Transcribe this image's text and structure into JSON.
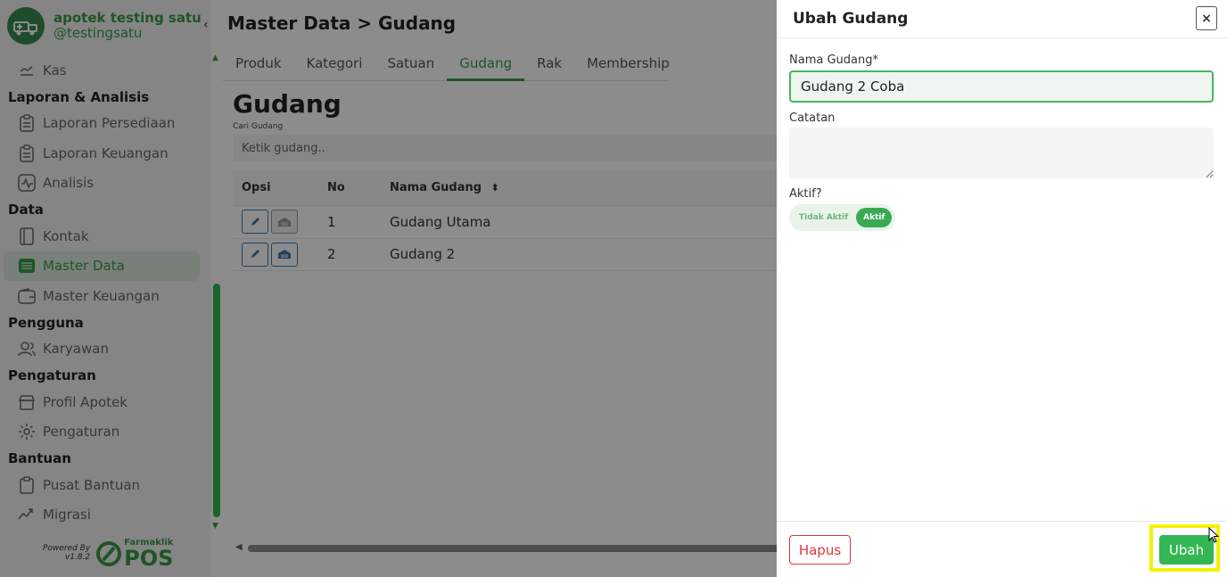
{
  "sidebar": {
    "brand_name": "apotek testing satu",
    "brand_handle": "@testingsatu",
    "collapse": "‹",
    "sections": [
      {
        "title": "",
        "items": [
          {
            "label": "Kas",
            "icon": "cash-icon"
          }
        ]
      },
      {
        "title": "Laporan & Analisis",
        "items": [
          {
            "label": "Laporan Persediaan",
            "icon": "clipboard-icon"
          },
          {
            "label": "Laporan Keuangan",
            "icon": "clipboard-icon"
          },
          {
            "label": "Analisis",
            "icon": "chart-pulse-icon"
          }
        ]
      },
      {
        "title": "Data",
        "items": [
          {
            "label": "Kontak",
            "icon": "book-icon"
          },
          {
            "label": "Master Data",
            "icon": "database-icon",
            "active": true
          },
          {
            "label": "Master Keuangan",
            "icon": "wallet-icon"
          }
        ]
      },
      {
        "title": "Pengguna",
        "items": [
          {
            "label": "Karyawan",
            "icon": "users-icon"
          }
        ]
      },
      {
        "title": "Pengaturan",
        "items": [
          {
            "label": "Profil Apotek",
            "icon": "store-icon"
          },
          {
            "label": "Pengaturan",
            "icon": "gear-icon"
          }
        ]
      },
      {
        "title": "Bantuan",
        "items": [
          {
            "label": "Pusat Bantuan",
            "icon": "clipboard-icon"
          },
          {
            "label": "Migrasi",
            "icon": "migrate-icon"
          }
        ]
      }
    ],
    "powered_by": "Powered By",
    "version": "v1.8.2",
    "product_small": "Farmaklik",
    "product_big": "POS"
  },
  "main": {
    "breadcrumb": "Master Data > Gudang",
    "tabs": [
      {
        "label": "Produk"
      },
      {
        "label": "Kategori"
      },
      {
        "label": "Satuan"
      },
      {
        "label": "Gudang",
        "active": true
      },
      {
        "label": "Rak"
      },
      {
        "label": "Membership"
      }
    ],
    "page_title": "Gudang",
    "search_label": "Cari Gudang",
    "search_placeholder": "Ketik gudang..",
    "columns": {
      "opsi": "Opsi",
      "no": "No",
      "nama": "Nama Gudang",
      "sort": "⬍"
    },
    "rows": [
      {
        "no": "1",
        "nama": "Gudang Utama",
        "active": false
      },
      {
        "no": "2",
        "nama": "Gudang 2",
        "active": true
      }
    ]
  },
  "modal": {
    "title": "Ubah Gudang",
    "close": "×",
    "name_label": "Nama Gudang*",
    "name_value": "Gudang 2 Coba",
    "note_label": "Catatan",
    "note_value": "",
    "active_label": "Aktif?",
    "toggle_off": "Tidak Aktif",
    "toggle_on": "Aktif",
    "delete_label": "Hapus",
    "submit_label": "Ubah"
  },
  "colors": {
    "brand_green": "#3a9a4a",
    "button_green": "#34b653",
    "danger_red": "#d9363e",
    "highlight_yellow": "#f2f200"
  }
}
